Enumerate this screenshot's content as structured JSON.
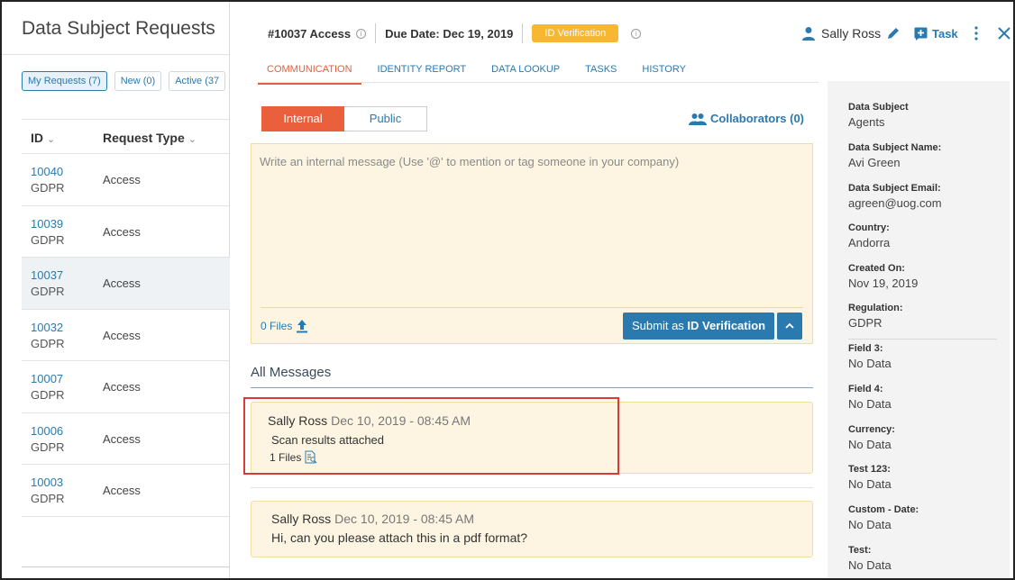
{
  "left": {
    "title": "Data Subject Requests",
    "filters": [
      "My Requests (7)",
      "New (0)",
      "Active (37"
    ],
    "col_id": "ID",
    "col_type": "Request Type",
    "rows": [
      {
        "id": "10040",
        "reg": "GDPR",
        "type": "Access"
      },
      {
        "id": "10039",
        "reg": "GDPR",
        "type": "Access"
      },
      {
        "id": "10037",
        "reg": "GDPR",
        "type": "Access"
      },
      {
        "id": "10032",
        "reg": "GDPR",
        "type": "Access"
      },
      {
        "id": "10007",
        "reg": "GDPR",
        "type": "Access"
      },
      {
        "id": "10006",
        "reg": "GDPR",
        "type": "Access"
      },
      {
        "id": "10003",
        "reg": "GDPR",
        "type": "Access"
      }
    ]
  },
  "header": {
    "request": "#10037 Access",
    "due": "Due Date: Dec 19, 2019",
    "badge": "ID Verification",
    "user": "Sally Ross",
    "task": "Task"
  },
  "tabs": [
    "COMMUNICATION",
    "IDENTITY REPORT",
    "DATA LOOKUP",
    "TASKS",
    "HISTORY"
  ],
  "composer": {
    "toggle_internal": "Internal",
    "toggle_public": "Public",
    "collaborators": "Collaborators (0)",
    "placeholder": "Write an internal message (Use '@' to mention or tag someone in your company)",
    "files": "0 Files",
    "submit_prefix": "Submit as ",
    "submit_bold": "ID Verification"
  },
  "messages": {
    "heading": "All Messages",
    "items": [
      {
        "author": "Sally Ross",
        "time": "Dec 10, 2019 - 08:45 AM",
        "text": "Scan results attached",
        "files": "1 Files"
      },
      {
        "author": "Sally Ross",
        "time": "Dec 10, 2019 - 08:45 AM",
        "text": "Hi, can you please attach this in a pdf format?"
      }
    ]
  },
  "sidebar": {
    "fields": [
      {
        "label": "Data Subject",
        "value": "Agents"
      },
      {
        "label": "Data Subject Name:",
        "value": "Avi Green"
      },
      {
        "label": "Data Subject Email:",
        "value": "agreen@uog.com"
      },
      {
        "label": "Country:",
        "value": "Andorra"
      },
      {
        "label": "Created On:",
        "value": "Nov 19, 2019"
      },
      {
        "label": "Regulation:",
        "value": "GDPR"
      },
      {
        "label": "Field 3:",
        "value": "No Data"
      },
      {
        "label": "Field 4:",
        "value": "No Data"
      },
      {
        "label": "Currency:",
        "value": "No Data"
      },
      {
        "label": "Test 123:",
        "value": "No Data"
      },
      {
        "label": "Custom - Date:",
        "value": "No Data"
      },
      {
        "label": "Test:",
        "value": "No Data"
      }
    ]
  },
  "colors": {
    "accent": "#2a7ab0",
    "active_tab": "#e2603e",
    "badge": "#f7b731",
    "highlight": "#d93a3a"
  }
}
